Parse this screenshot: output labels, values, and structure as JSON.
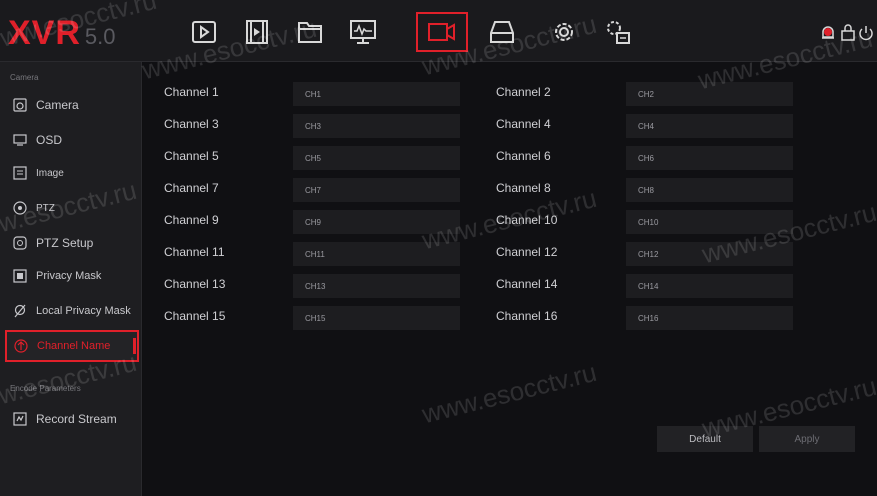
{
  "header": {
    "logo_brand": "XVR",
    "logo_version": "5.0",
    "nav_icons": [
      "playback-icon",
      "video-clip-icon",
      "file-icon",
      "system-info-icon",
      "camera-icon",
      "storage-icon",
      "settings-icon",
      "advanced-settings-icon"
    ],
    "active_nav": "camera-icon"
  },
  "sidebar": {
    "camera_section": "Camera",
    "encode_section": "Encode Parameters",
    "items": [
      {
        "label": "Camera",
        "icon": "camera-small-icon"
      },
      {
        "label": "OSD",
        "icon": "monitor-icon"
      },
      {
        "label": "Image",
        "icon": "image-settings-icon"
      },
      {
        "label": "PTZ",
        "icon": "ptz-icon"
      },
      {
        "label": "PTZ Setup",
        "icon": "ptz-setup-icon"
      },
      {
        "label": "Privacy Mask",
        "icon": "privacy-mask-icon"
      },
      {
        "label": "Local Privacy Mask",
        "icon": "local-privacy-mask-icon"
      },
      {
        "label": "Channel Name",
        "icon": "channel-name-icon"
      },
      {
        "label": "Record Stream",
        "icon": "record-stream-icon"
      }
    ],
    "active_item": "Channel Name"
  },
  "channels": [
    {
      "label": "Channel 1",
      "value": "CH1"
    },
    {
      "label": "Channel 2",
      "value": "CH2"
    },
    {
      "label": "Channel 3",
      "value": "CH3"
    },
    {
      "label": "Channel 4",
      "value": "CH4"
    },
    {
      "label": "Channel 5",
      "value": "CH5"
    },
    {
      "label": "Channel 6",
      "value": "CH6"
    },
    {
      "label": "Channel 7",
      "value": "CH7"
    },
    {
      "label": "Channel 8",
      "value": "CH8"
    },
    {
      "label": "Channel 9",
      "value": "CH9"
    },
    {
      "label": "Channel 10",
      "value": "CH10"
    },
    {
      "label": "Channel 11",
      "value": "CH11"
    },
    {
      "label": "Channel 12",
      "value": "CH12"
    },
    {
      "label": "Channel 13",
      "value": "CH13"
    },
    {
      "label": "Channel 14",
      "value": "CH14"
    },
    {
      "label": "Channel 15",
      "value": "CH15"
    },
    {
      "label": "Channel 16",
      "value": "CH16"
    }
  ],
  "buttons": {
    "default": "Default",
    "apply": "Apply"
  },
  "watermark": "www.esocctv.ru",
  "colors": {
    "accent": "#e0202a",
    "background": "#101013",
    "panel": "#1e1e21"
  }
}
